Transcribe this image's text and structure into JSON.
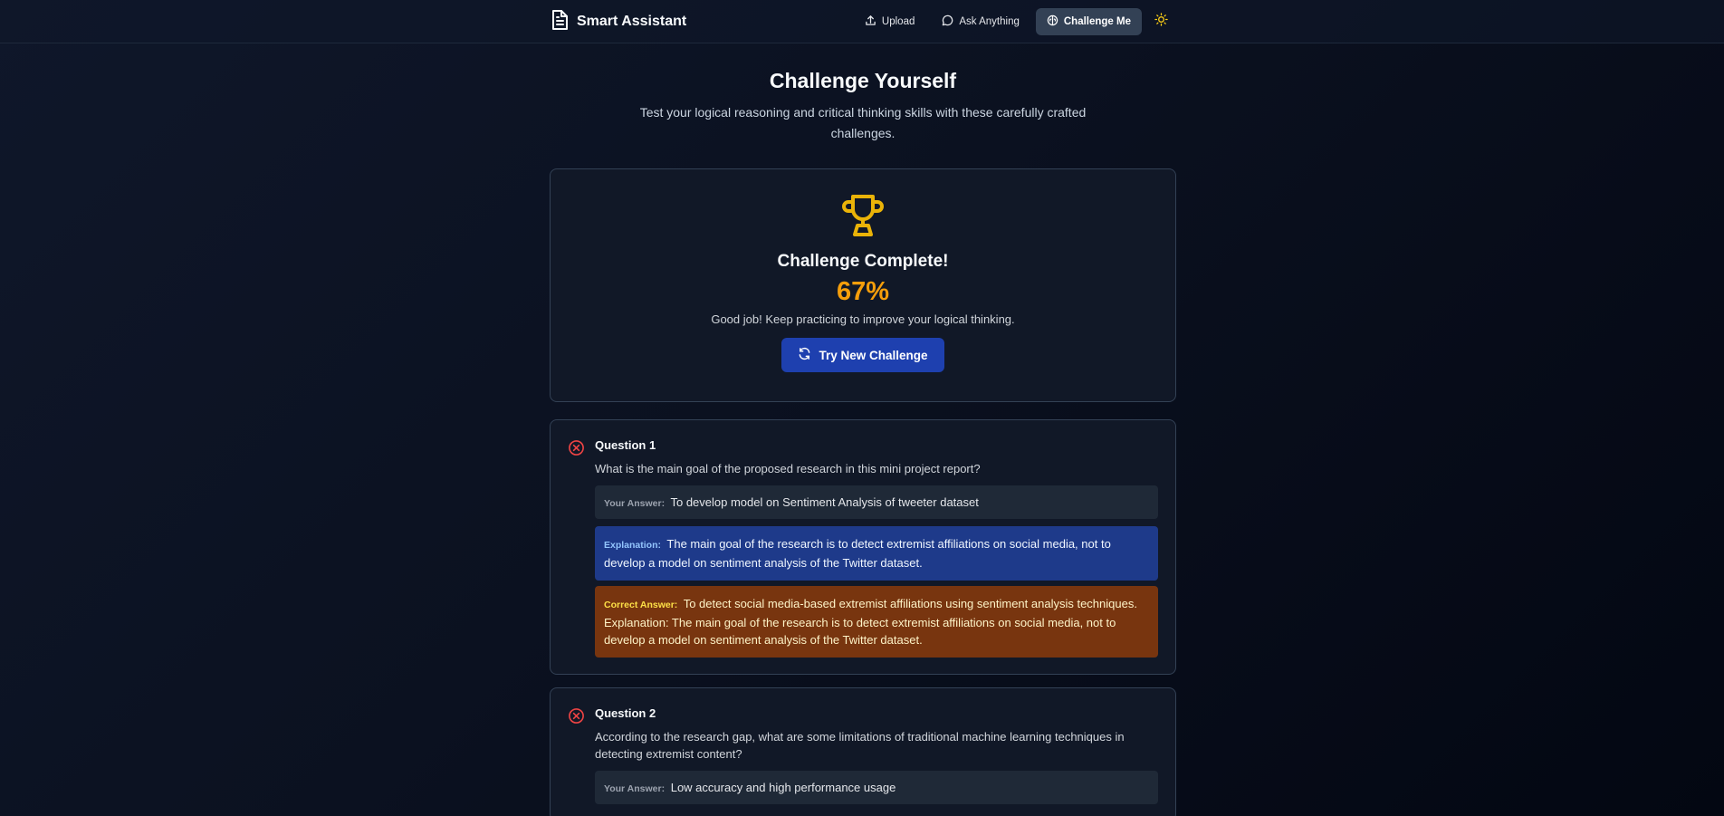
{
  "header": {
    "app_title": "Smart Assistant",
    "nav": {
      "upload": "Upload",
      "ask": "Ask Anything",
      "challenge": "Challenge Me"
    }
  },
  "hero": {
    "title": "Challenge Yourself",
    "subtitle": "Test your logical reasoning and critical thinking skills with these carefully crafted challenges."
  },
  "result": {
    "title": "Challenge Complete!",
    "score": "67%",
    "message": "Good job! Keep practicing to improve your logical thinking.",
    "retry_label": "Try New Challenge"
  },
  "labels": {
    "your_answer": "Your Answer:",
    "explanation": "Explanation:",
    "correct_answer": "Correct Answer:"
  },
  "questions": [
    {
      "title": "Question 1",
      "text": "What is the main goal of the proposed research in this mini project report?",
      "your_answer": "To develop model on Sentiment Analysis of tweeter dataset",
      "explanation": "The main goal of the research is to detect extremist affiliations on social media, not to develop a model on sentiment analysis of the Twitter dataset.",
      "correct_answer": "To detect social media-based extremist affiliations using sentiment analysis techniques. Explanation: The main goal of the research is to detect extremist affiliations on social media, not to develop a model on sentiment analysis of the Twitter dataset.",
      "status": "incorrect"
    },
    {
      "title": "Question 2",
      "text": "According to the research gap, what are some limitations of traditional machine learning techniques in detecting extremist content?",
      "your_answer": "Low accuracy and high performance usage",
      "status": "incorrect"
    }
  ],
  "icons": {
    "brand": "document-icon",
    "upload": "upload-icon",
    "ask": "chat-bubble-icon",
    "challenge": "brain-icon",
    "theme": "sun-icon",
    "trophy": "trophy-icon",
    "retry": "refresh-icon",
    "incorrect": "x-circle-icon"
  },
  "colors": {
    "accent": "#f59e0b",
    "primary_button": "#1e40af",
    "incorrect": "#ef4444",
    "explanation_bg": "#1e3a8a",
    "correct_bg": "#78350f"
  }
}
